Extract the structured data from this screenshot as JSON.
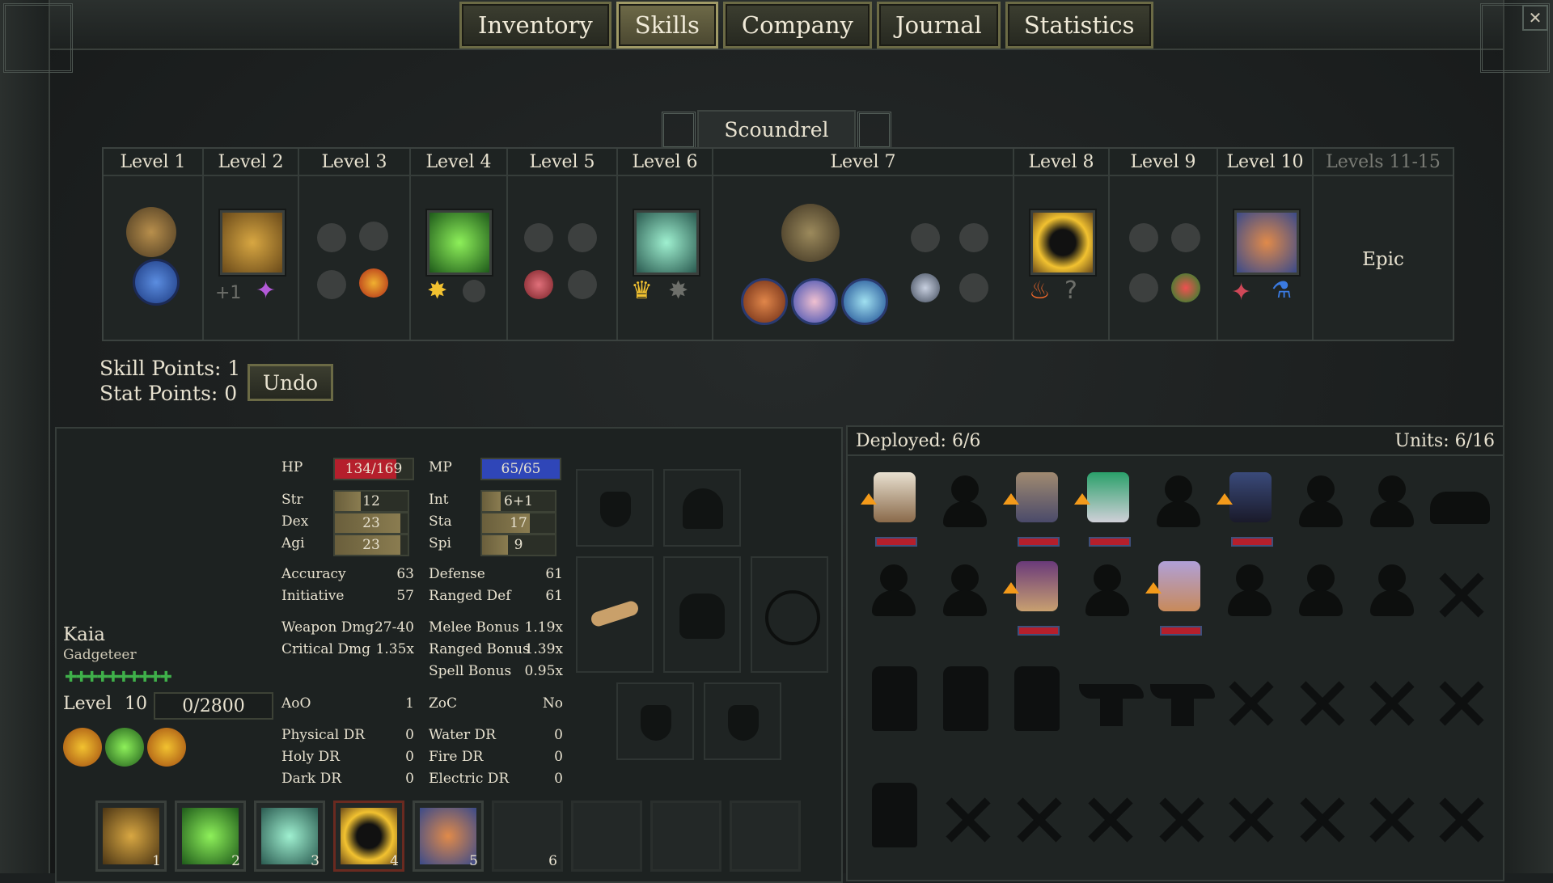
{
  "tabs": [
    "Inventory",
    "Skills",
    "Company",
    "Journal",
    "Statistics"
  ],
  "active_tab": "Skills",
  "class_name": "Scoundrel",
  "levels": [
    "Level 1",
    "Level 2",
    "Level 3",
    "Level 4",
    "Level 5",
    "Level 6",
    "Level 7",
    "Level 8",
    "Level 9",
    "Level 10",
    "Levels 11-15"
  ],
  "epic_label": "Epic",
  "skill_points_label": "Skill Points: 1",
  "stat_points_label": "Stat Points: 0",
  "undo_label": "Undo",
  "character": {
    "name": "Kaia",
    "class": "Gadgeteer",
    "level_label": "Level",
    "level": "10",
    "xp": "0/2800",
    "pips": "✚✚✚✚✚✚✚✚✚✚"
  },
  "stats": {
    "hp_label": "HP",
    "hp": "134/169",
    "hp_fraction": 0.79,
    "mp_label": "MP",
    "mp": "65/65",
    "mp_fraction": 1.0,
    "str_label": "Str",
    "str": "12",
    "str_fraction": 0.35,
    "dex_label": "Dex",
    "dex": "23",
    "dex_fraction": 0.9,
    "agi_label": "Agi",
    "agi": "23",
    "agi_fraction": 0.9,
    "int_label": "Int",
    "int": "6+1",
    "int_fraction": 0.25,
    "sta_label": "Sta",
    "sta": "17",
    "sta_fraction": 0.65,
    "spi_label": "Spi",
    "spi": "9",
    "spi_fraction": 0.35,
    "accuracy_label": "Accuracy",
    "accuracy": "63",
    "defense_label": "Defense",
    "defense": "61",
    "initiative_label": "Initiative",
    "initiative": "57",
    "ranged_def_label": "Ranged Def",
    "ranged_def": "61",
    "weapon_dmg_label": "Weapon Dmg",
    "weapon_dmg": "27-40",
    "melee_bonus_label": "Melee Bonus",
    "melee_bonus": "1.19x",
    "crit_dmg_label": "Critical Dmg",
    "crit_dmg": "1.35x",
    "ranged_bonus_label": "Ranged Bonus",
    "ranged_bonus": "1.39x",
    "spell_bonus_label": "Spell Bonus",
    "spell_bonus": "0.95x",
    "aoo_label": "AoO",
    "aoo": "1",
    "zoc_label": "ZoC",
    "zoc": "No",
    "physical_dr_label": "Physical DR",
    "physical_dr": "0",
    "water_dr_label": "Water DR",
    "water_dr": "0",
    "holy_dr_label": "Holy DR",
    "holy_dr": "0",
    "fire_dr_label": "Fire DR",
    "fire_dr": "0",
    "dark_dr_label": "Dark DR",
    "dark_dr": "0",
    "electric_dr_label": "Electric DR",
    "electric_dr": "0"
  },
  "hotbar": [
    "1",
    "2",
    "3",
    "4",
    "5",
    "6"
  ],
  "company": {
    "deployed_label": "Deployed: 6/6",
    "units_label": "Units: 6/16"
  },
  "colors": {
    "hp": "#b51f2c",
    "mp": "#2f46b8",
    "pips": "#3fb04a",
    "upgrade_arrow": "#f39a1a"
  }
}
